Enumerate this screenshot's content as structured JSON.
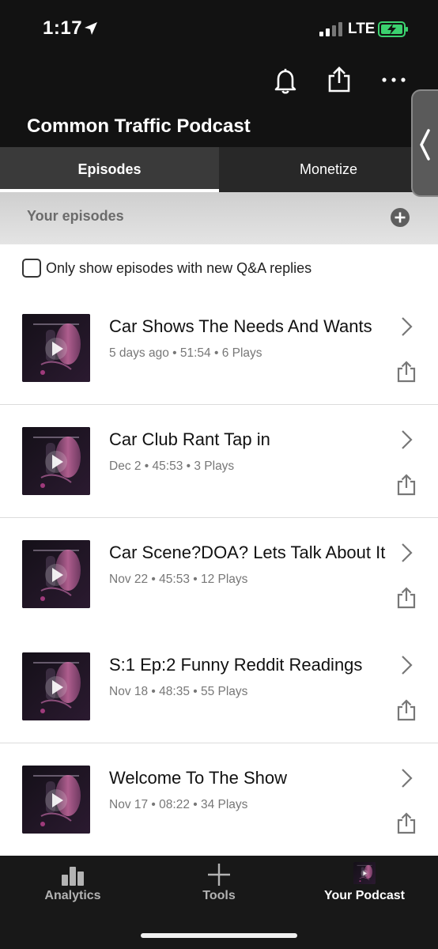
{
  "status_bar": {
    "time": "1:17",
    "network": "LTE"
  },
  "header": {
    "title": "Common Traffic Podcast",
    "icons": [
      "bell-icon",
      "share-icon",
      "more-icon"
    ]
  },
  "tabs": [
    {
      "label": "Episodes",
      "active": true
    },
    {
      "label": "Monetize",
      "active": false
    }
  ],
  "episodes_section": {
    "label": "Your episodes",
    "add_icon": "plus-circle-icon"
  },
  "filter": {
    "label": "Only show episodes with new Q&A replies",
    "checked": false
  },
  "episodes": [
    {
      "title": "Car Shows The Needs And Wants",
      "meta": "5 days ago • 51:54 • 6 Plays"
    },
    {
      "title": "Car Club Rant Tap in",
      "meta": "Dec 2 • 45:53 • 3 Plays"
    },
    {
      "title": "Car Scene?DOA? Lets Talk About It",
      "meta": "Nov 22 • 45:53 • 12 Plays"
    },
    {
      "title": "S:1 Ep:2 Funny Reddit Readings",
      "meta": "Nov 18 • 48:35 • 55 Plays"
    },
    {
      "title": "Welcome To The Show",
      "meta": "Nov 17 • 08:22 • 34 Plays"
    }
  ],
  "bottom_nav": [
    {
      "label": "Analytics",
      "icon": "bar-chart-icon",
      "active": false
    },
    {
      "label": "Tools",
      "icon": "plus-icon",
      "active": false
    },
    {
      "label": "Your Podcast",
      "icon": "podcast-cover-icon",
      "active": true
    }
  ],
  "colors": {
    "dark_bg": "#121212",
    "tab_bg": "#282828",
    "nav_bg": "#181818",
    "text_primary": "#111111",
    "text_secondary": "#777777"
  }
}
